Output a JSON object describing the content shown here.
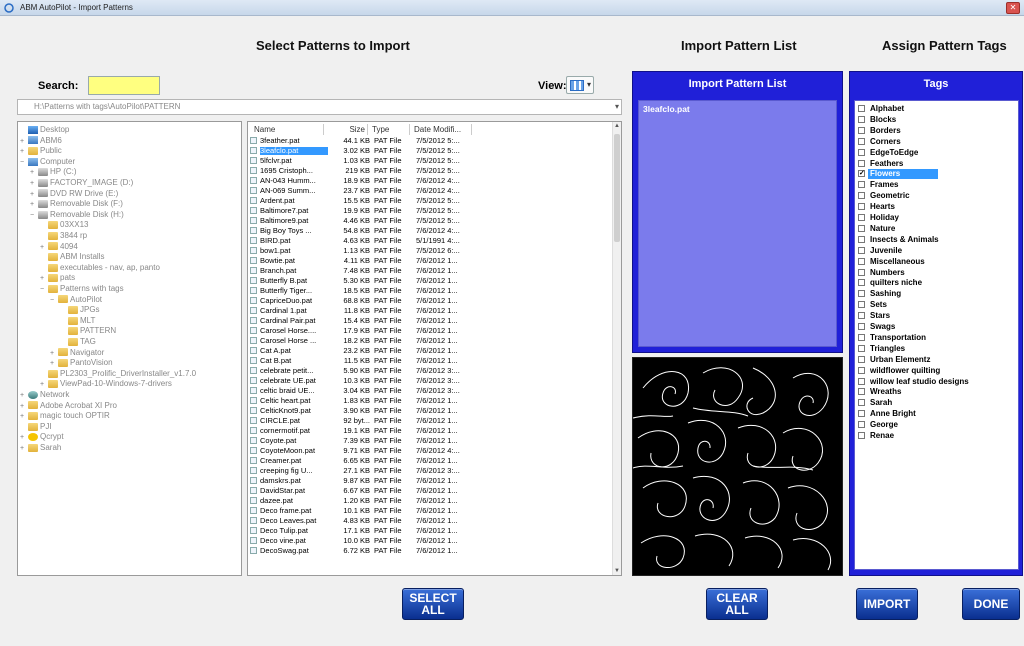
{
  "window": {
    "title": "ABM AutoPilot - Import Patterns",
    "close_glyph": "✕"
  },
  "headers": {
    "select": "Select Patterns to Import",
    "import_list": "Import Pattern List",
    "assign_tags": "Assign Pattern Tags"
  },
  "search": {
    "label": "Search:",
    "value": ""
  },
  "view": {
    "label": "View:"
  },
  "path": "H:\\Patterns with tags\\AutoPilot\\PATTERN",
  "tree": [
    {
      "label": "Desktop",
      "icon": "desktop-icon",
      "level": 0,
      "exp": ""
    },
    {
      "label": "ABM6",
      "icon": "computer-icon",
      "level": 0,
      "exp": "+"
    },
    {
      "label": "Public",
      "icon": "folder-icon",
      "level": 0,
      "exp": "+"
    },
    {
      "label": "Computer",
      "icon": "computer-icon",
      "level": 0,
      "exp": "−"
    },
    {
      "label": "HP (C:)",
      "icon": "drive-icon",
      "level": 1,
      "exp": "+"
    },
    {
      "label": "FACTORY_IMAGE (D:)",
      "icon": "drive-icon",
      "level": 1,
      "exp": "+"
    },
    {
      "label": "DVD RW Drive (E:)",
      "icon": "drive-icon",
      "level": 1,
      "exp": "+"
    },
    {
      "label": "Removable Disk (F:)",
      "icon": "drive-icon",
      "level": 1,
      "exp": "+"
    },
    {
      "label": "Removable Disk (H:)",
      "icon": "drive-icon",
      "level": 1,
      "exp": "−"
    },
    {
      "label": "03XX13",
      "icon": "folder-icon",
      "level": 2,
      "exp": ""
    },
    {
      "label": "3844 rp",
      "icon": "folder-icon",
      "level": 2,
      "exp": ""
    },
    {
      "label": "4094",
      "icon": "folder-icon",
      "level": 2,
      "exp": "+"
    },
    {
      "label": "ABM Installs",
      "icon": "folder-icon",
      "level": 2,
      "exp": ""
    },
    {
      "label": "executables - nav, ap, panto",
      "icon": "folder-icon",
      "level": 2,
      "exp": ""
    },
    {
      "label": "pats",
      "icon": "folder-icon",
      "level": 2,
      "exp": "+"
    },
    {
      "label": "Patterns with tags",
      "icon": "folder-icon",
      "level": 2,
      "exp": "−"
    },
    {
      "label": "AutoPilot",
      "icon": "folder-icon",
      "level": 3,
      "exp": "−"
    },
    {
      "label": "JPGs",
      "icon": "folder-icon",
      "level": 4,
      "exp": ""
    },
    {
      "label": "MLT",
      "icon": "folder-icon",
      "level": 4,
      "exp": ""
    },
    {
      "label": "PATTERN",
      "icon": "folder-icon",
      "level": 4,
      "exp": ""
    },
    {
      "label": "TAG",
      "icon": "folder-icon",
      "level": 4,
      "exp": ""
    },
    {
      "label": "Navigator",
      "icon": "folder-icon",
      "level": 3,
      "exp": "+"
    },
    {
      "label": "PantoVision",
      "icon": "folder-icon",
      "level": 3,
      "exp": "+"
    },
    {
      "label": "PL2303_Prolific_DriverInstaller_v1.7.0",
      "icon": "folder-icon",
      "level": 2,
      "exp": ""
    },
    {
      "label": "ViewPad-10-Windows-7-drivers",
      "icon": "folder-icon",
      "level": 2,
      "exp": "+"
    },
    {
      "label": "Network",
      "icon": "network-icon",
      "level": 0,
      "exp": "+"
    },
    {
      "label": "Adobe Acrobat XI Pro",
      "icon": "folder-icon",
      "level": 0,
      "exp": "+"
    },
    {
      "label": "magic touch OPTIR",
      "icon": "folder-icon",
      "level": 0,
      "exp": "+"
    },
    {
      "label": "PJI",
      "icon": "folder-icon",
      "level": 0,
      "exp": ""
    },
    {
      "label": "Qcrypt",
      "icon": "dot-icon",
      "level": 0,
      "exp": "+"
    },
    {
      "label": "Sarah",
      "icon": "folder-icon",
      "level": 0,
      "exp": "+"
    }
  ],
  "files": {
    "columns": [
      "Name",
      "Size",
      "Type",
      "Date Modifi..."
    ],
    "rows": [
      {
        "name": "3feather.pat",
        "size": "44.1 KB",
        "type": "PAT File",
        "date": "7/5/2012 5:..."
      },
      {
        "name": "3leafclo.pat",
        "size": "3.02 KB",
        "type": "PAT File",
        "date": "7/5/2012 5:...",
        "selected": true
      },
      {
        "name": "5lfclvr.pat",
        "size": "1.03 KB",
        "type": "PAT File",
        "date": "7/5/2012 5:..."
      },
      {
        "name": "1695 Cristoph...",
        "size": "219 KB",
        "type": "PAT File",
        "date": "7/5/2012 5:..."
      },
      {
        "name": "AN-043 Humm...",
        "size": "18.9 KB",
        "type": "PAT File",
        "date": "7/6/2012 4:..."
      },
      {
        "name": "AN-069 Summ...",
        "size": "23.7 KB",
        "type": "PAT File",
        "date": "7/6/2012 4:..."
      },
      {
        "name": "Ardent.pat",
        "size": "15.5 KB",
        "type": "PAT File",
        "date": "7/5/2012 5:..."
      },
      {
        "name": "Baltimore7.pat",
        "size": "19.9 KB",
        "type": "PAT File",
        "date": "7/5/2012 5:..."
      },
      {
        "name": "Baltimore9.pat",
        "size": "4.46 KB",
        "type": "PAT File",
        "date": "7/5/2012 5:..."
      },
      {
        "name": "Big Boy Toys ...",
        "size": "54.8 KB",
        "type": "PAT File",
        "date": "7/6/2012 4:..."
      },
      {
        "name": "BIRD.pat",
        "size": "4.63 KB",
        "type": "PAT File",
        "date": "5/1/1991 4:..."
      },
      {
        "name": "bow1.pat",
        "size": "1.13 KB",
        "type": "PAT File",
        "date": "7/5/2012 6:..."
      },
      {
        "name": "Bowtie.pat",
        "size": "4.11 KB",
        "type": "PAT File",
        "date": "7/6/2012 1..."
      },
      {
        "name": "Branch.pat",
        "size": "7.48 KB",
        "type": "PAT File",
        "date": "7/6/2012 1..."
      },
      {
        "name": "Butterfly B.pat",
        "size": "5.30 KB",
        "type": "PAT File",
        "date": "7/6/2012 1..."
      },
      {
        "name": "Butterfly Tiger...",
        "size": "18.5 KB",
        "type": "PAT File",
        "date": "7/6/2012 1..."
      },
      {
        "name": "CapriceDuo.pat",
        "size": "68.8 KB",
        "type": "PAT File",
        "date": "7/6/2012 1..."
      },
      {
        "name": "Cardinal 1.pat",
        "size": "11.8 KB",
        "type": "PAT File",
        "date": "7/6/2012 1..."
      },
      {
        "name": "Cardinal Pair.pat",
        "size": "15.4 KB",
        "type": "PAT File",
        "date": "7/6/2012 1..."
      },
      {
        "name": "Carosel Horse....",
        "size": "17.9 KB",
        "type": "PAT File",
        "date": "7/6/2012 1..."
      },
      {
        "name": "Carosel Horse ...",
        "size": "18.2 KB",
        "type": "PAT File",
        "date": "7/6/2012 1..."
      },
      {
        "name": "Cat A.pat",
        "size": "23.2 KB",
        "type": "PAT File",
        "date": "7/6/2012 1..."
      },
      {
        "name": "Cat B.pat",
        "size": "11.5 KB",
        "type": "PAT File",
        "date": "7/6/2012 1..."
      },
      {
        "name": "celebrate petit...",
        "size": "5.90 KB",
        "type": "PAT File",
        "date": "7/6/2012 3:..."
      },
      {
        "name": "celebrate UE.pat",
        "size": "10.3 KB",
        "type": "PAT File",
        "date": "7/6/2012 3:..."
      },
      {
        "name": "celtic braid UE...",
        "size": "3.04 KB",
        "type": "PAT File",
        "date": "7/6/2012 3:..."
      },
      {
        "name": "Celtic heart.pat",
        "size": "1.83 KB",
        "type": "PAT File",
        "date": "7/6/2012 1..."
      },
      {
        "name": "CelticKnot9.pat",
        "size": "3.90 KB",
        "type": "PAT File",
        "date": "7/6/2012 1..."
      },
      {
        "name": "CIRCLE.pat",
        "size": "92 byt...",
        "type": "PAT File",
        "date": "7/6/2012 1..."
      },
      {
        "name": "cornermotif.pat",
        "size": "19.1 KB",
        "type": "PAT File",
        "date": "7/6/2012 1..."
      },
      {
        "name": "Coyote.pat",
        "size": "7.39 KB",
        "type": "PAT File",
        "date": "7/6/2012 1..."
      },
      {
        "name": "CoyoteMoon.pat",
        "size": "9.71 KB",
        "type": "PAT File",
        "date": "7/6/2012 4:..."
      },
      {
        "name": "Creamer.pat",
        "size": "6.65 KB",
        "type": "PAT File",
        "date": "7/6/2012 1..."
      },
      {
        "name": "creeping fig U...",
        "size": "27.1 KB",
        "type": "PAT File",
        "date": "7/6/2012 3:..."
      },
      {
        "name": "damskrs.pat",
        "size": "9.87 KB",
        "type": "PAT File",
        "date": "7/6/2012 1..."
      },
      {
        "name": "DavidStar.pat",
        "size": "6.67 KB",
        "type": "PAT File",
        "date": "7/6/2012 1..."
      },
      {
        "name": "dazee.pat",
        "size": "1.20 KB",
        "type": "PAT File",
        "date": "7/6/2012 1..."
      },
      {
        "name": "Deco frame.pat",
        "size": "10.1 KB",
        "type": "PAT File",
        "date": "7/6/2012 1..."
      },
      {
        "name": "Deco Leaves.pat",
        "size": "4.83 KB",
        "type": "PAT File",
        "date": "7/6/2012 1..."
      },
      {
        "name": "Deco Tulip.pat",
        "size": "17.1 KB",
        "type": "PAT File",
        "date": "7/6/2012 1..."
      },
      {
        "name": "Deco vine.pat",
        "size": "10.0 KB",
        "type": "PAT File",
        "date": "7/6/2012 1..."
      },
      {
        "name": "DecoSwag.pat",
        "size": "6.72 KB",
        "type": "PAT File",
        "date": "7/6/2012 1..."
      }
    ]
  },
  "import_list": {
    "title": "Import Pattern List",
    "items": [
      "3leafclo.pat"
    ]
  },
  "tags": {
    "title": "Tags",
    "items": [
      {
        "label": "Alphabet",
        "checked": false
      },
      {
        "label": "Blocks",
        "checked": false
      },
      {
        "label": "Borders",
        "checked": false
      },
      {
        "label": "Corners",
        "checked": false
      },
      {
        "label": "EdgeToEdge",
        "checked": false
      },
      {
        "label": "Feathers",
        "checked": false
      },
      {
        "label": "Flowers",
        "checked": true
      },
      {
        "label": "Frames",
        "checked": false
      },
      {
        "label": "Geometric",
        "checked": false
      },
      {
        "label": "Hearts",
        "checked": false
      },
      {
        "label": "Holiday",
        "checked": false
      },
      {
        "label": "Nature",
        "checked": false
      },
      {
        "label": "Insects & Animals",
        "checked": false
      },
      {
        "label": "Juvenile",
        "checked": false
      },
      {
        "label": "Miscellaneous",
        "checked": false
      },
      {
        "label": "Numbers",
        "checked": false
      },
      {
        "label": "quilters niche",
        "checked": false
      },
      {
        "label": "Sashing",
        "checked": false
      },
      {
        "label": "Sets",
        "checked": false
      },
      {
        "label": "Stars",
        "checked": false
      },
      {
        "label": "Swags",
        "checked": false
      },
      {
        "label": "Transportation",
        "checked": false
      },
      {
        "label": "Triangles",
        "checked": false
      },
      {
        "label": "Urban Elementz",
        "checked": false
      },
      {
        "label": "wildflower quilting",
        "checked": false
      },
      {
        "label": "willow leaf studio designs",
        "checked": false
      },
      {
        "label": "Wreaths",
        "checked": false
      },
      {
        "label": "Sarah",
        "checked": false
      },
      {
        "label": "Anne Bright",
        "checked": false
      },
      {
        "label": "George",
        "checked": false
      },
      {
        "label": "Renae",
        "checked": false
      }
    ]
  },
  "buttons": {
    "select_all": {
      "line1": "SELECT",
      "line2": "ALL"
    },
    "clear_all": {
      "line1": "CLEAR",
      "line2": "ALL"
    },
    "import": "IMPORT",
    "done": "DONE"
  },
  "colors": {
    "panel_blue": "#2020d8",
    "list_lavender": "#7b7bec",
    "search_yellow": "#ffff80",
    "selection": "#3399ff"
  }
}
